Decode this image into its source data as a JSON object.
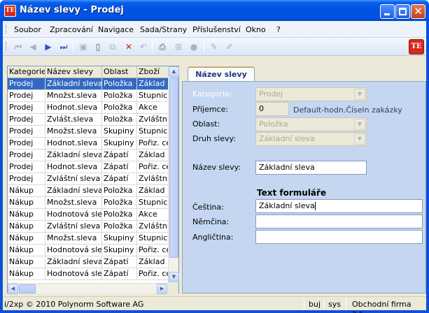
{
  "window": {
    "title": "Název slevy - Prodej",
    "logo_text": "TE"
  },
  "menu": [
    "Soubor",
    "Zpracování",
    "Navigace",
    "Sada/Strany",
    "Příslušenství",
    "Okno",
    "?"
  ],
  "toolbar": {
    "brand_text": "TE",
    "icons": [
      "first-record-icon",
      "previous-record-icon",
      "next-record-icon",
      "last-record-icon",
      "save-icon",
      "new-icon",
      "copy-icon",
      "delete-icon",
      "undo-icon",
      "print-icon",
      "tree-icon",
      "disabled-icon",
      "edit-icon",
      "edit-clear-icon"
    ]
  },
  "grid": {
    "columns": [
      "Kategorie",
      "Název slevy",
      "Oblast",
      "Zboží"
    ],
    "rows": [
      [
        "Prodej",
        "Základní sleva",
        "Položka",
        "Základ"
      ],
      [
        "Prodej",
        "Množst.sleva",
        "Položka",
        "Stupnice"
      ],
      [
        "Prodej",
        "Hodnot.sleva",
        "Položka",
        "Akce"
      ],
      [
        "Prodej",
        "Zvlášt.sleva",
        "Položka",
        "Zvláštní"
      ],
      [
        "Prodej",
        "Množst.sleva",
        "Skupiny",
        "Stupnice"
      ],
      [
        "Prodej",
        "Hodnot.sleva",
        "Skupiny",
        "Pořiz. ce"
      ],
      [
        "Prodej",
        "Základní sleva",
        "Zápatí",
        "Základ"
      ],
      [
        "Prodej",
        "Hodnot.sleva",
        "Zápatí",
        "Pořiz. ce"
      ],
      [
        "Prodej",
        "Zvláštní sleva",
        "Zápatí",
        "Zvláštní"
      ],
      [
        "Nákup",
        "Základní sleva",
        "Položka",
        "Základ"
      ],
      [
        "Nákup",
        "Množst.sleva",
        "Položka",
        "Stupnice"
      ],
      [
        "Nákup",
        "Hodnotová slev.",
        "Položka",
        "Akce"
      ],
      [
        "Nákup",
        "Zvláštní sleva",
        "Položka",
        "Zvláštní"
      ],
      [
        "Nákup",
        "Množst.sleva",
        "Skupiny",
        "Stupnice"
      ],
      [
        "Nákup",
        "Hodnotová slev.",
        "Skupiny",
        "Pořiz. ce"
      ],
      [
        "Nákup",
        "Základní sleva",
        "Zápatí",
        "Základ"
      ],
      [
        "Nákup",
        "Hodnotová slev.",
        "Zápatí",
        "Pořiz. ce"
      ]
    ],
    "selected_row": 0
  },
  "form": {
    "tab_label": "Název slevy",
    "kategorie_label": "Kategorie:",
    "kategorie_value": "Prodej",
    "prijemce_label": "Příjemce:",
    "prijemce_value": "0",
    "prijemce_note": "Default-hodn.Číseln zakázky",
    "oblast_label": "Oblast:",
    "oblast_value": "Položka",
    "druh_label": "Druh slevy:",
    "druh_value": "Základní sleva",
    "nazev_label": "Název slevy:",
    "nazev_value": "Základní sleva",
    "section_title": "Text formuláře",
    "cestina_label": "Čeština:",
    "cestina_value": "Základní sleva",
    "nemcina_label": "Němčina:",
    "nemcina_value": "",
    "anglictina_label": "Angličtina:",
    "anglictina_value": ""
  },
  "status": {
    "copyright": "i/2xp © 2010 Polynorm Software AG",
    "user": "buj",
    "system": "sys",
    "company": "Obchodní firma a.s."
  }
}
